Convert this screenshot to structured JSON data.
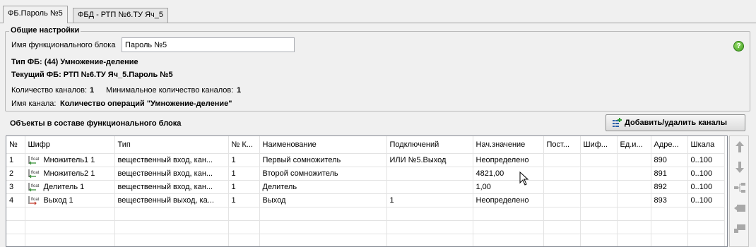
{
  "tabs": [
    {
      "label": "ФБ.Пароль №5",
      "active": true
    },
    {
      "label": "ФБД -  РТП №6.ТУ Яч_5",
      "active": false
    }
  ],
  "general": {
    "title": "Общие настройки",
    "name_label": "Имя функционального блока",
    "name_value": "Пароль №5",
    "fb_type": "Тип ФБ: (44) Умножение-деление",
    "current_fb": "Текущий ФБ:  РТП №6.ТУ Яч_5.Пароль №5",
    "channels_label": "Количество каналов:",
    "channels_value": "1",
    "min_channels_label": "Минимальное количество каналов:",
    "min_channels_value": "1",
    "channel_name_label": "Имя канала:",
    "channel_name_value": "Количество операций \"Умножение-деление\"",
    "help_icon": "help-icon",
    "help_color": "#3c9a1c"
  },
  "objects": {
    "title": "Объекты в составе функционального блока",
    "add_button": "Добавить/удалить каналы",
    "columns": [
      "№",
      "Шифр",
      "Тип",
      "№ К...",
      "Наименование",
      "Подключений",
      "Нач.значение",
      "Пост...",
      "Шиф...",
      "Ед.и...",
      "Адре...",
      "Шкала"
    ],
    "rows": [
      {
        "n": "1",
        "code": "Множитель1 1",
        "type": "вещественный вход, кан...",
        "k": "1",
        "name": "Первый сомножитель",
        "conn": "ИЛИ №5.Выход",
        "init": "Неопределено",
        "post": "",
        "shif": "",
        "unit": "",
        "addr": "890",
        "scale": "0..100",
        "icon": "float-input-icon"
      },
      {
        "n": "2",
        "code": "Множитель2 1",
        "type": "вещественный вход, кан...",
        "k": "1",
        "name": "Второй сомножитель",
        "conn": "",
        "init": "4821,00",
        "post": "",
        "shif": "",
        "unit": "",
        "addr": "891",
        "scale": "0..100",
        "icon": "float-input-icon"
      },
      {
        "n": "3",
        "code": "Делитель 1",
        "type": "вещественный вход, кан...",
        "k": "1",
        "name": "Делитель",
        "conn": "",
        "init": "1,00",
        "post": "",
        "shif": "",
        "unit": "",
        "addr": "892",
        "scale": "0..100",
        "icon": "float-input-icon"
      },
      {
        "n": "4",
        "code": "Выход 1",
        "type": "вещественный выход, ка...",
        "k": "1",
        "name": "Выход",
        "conn": "1",
        "init": "Неопределено",
        "post": "",
        "shif": "",
        "unit": "",
        "addr": "893",
        "scale": "0..100",
        "icon": "float-output-icon"
      }
    ],
    "float_icon_text": "float"
  },
  "side_buttons": [
    "arrow-up-icon",
    "arrow-down-icon",
    "link-icon",
    "move-icon",
    "delete-icon"
  ]
}
